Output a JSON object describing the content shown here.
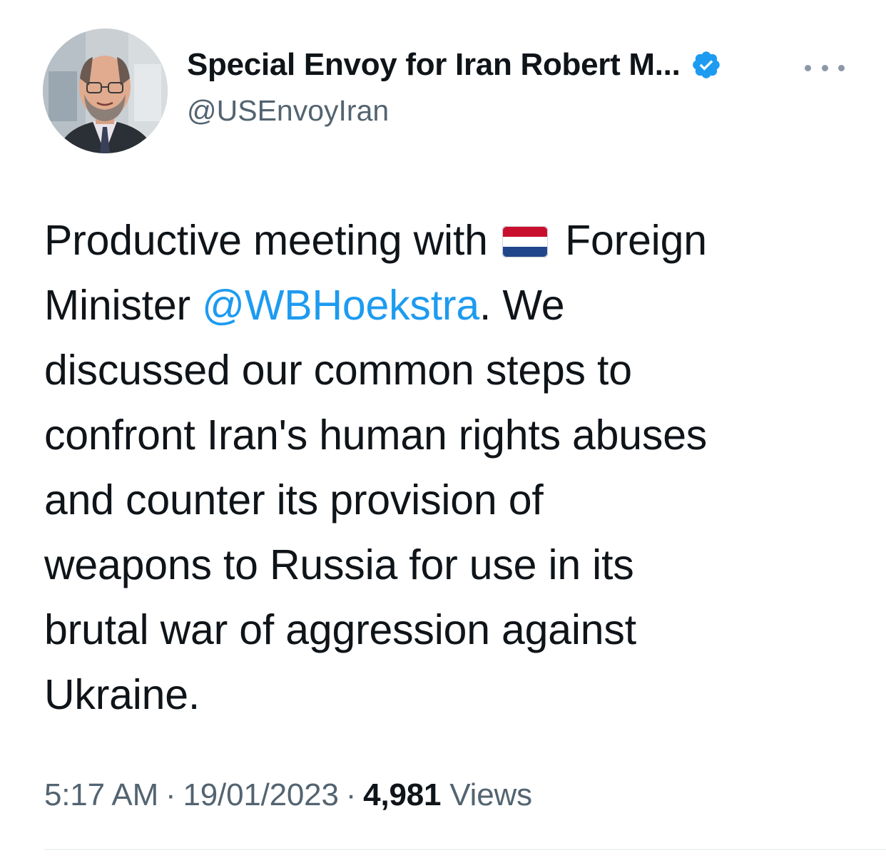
{
  "author": {
    "display_name": "Special Envoy for Iran Robert M...",
    "handle": "@USEnvoyIran",
    "verified": true,
    "avatar_icon": "profile-photo"
  },
  "tweet": {
    "lines": [
      {
        "before": "Productive meeting with",
        "flag": "netherlands-flag-icon",
        "after": "Foreign"
      },
      {
        "before": "Minister ",
        "mention": "@WBHoekstra",
        "after": ". We"
      },
      {
        "text": "discussed our common steps to"
      },
      {
        "text": "confront Iran's human rights abuses"
      },
      {
        "text": "and counter its provision of"
      },
      {
        "text": "weapons to Russia for use in its"
      },
      {
        "text": "brutal war of aggression against"
      },
      {
        "text": "Ukraine."
      }
    ]
  },
  "meta": {
    "time": "5:17 AM",
    "separator": "·",
    "date": "19/01/2023",
    "views_count": "4,981",
    "views_label": "Views"
  },
  "colors": {
    "link": "#1d9bf0",
    "verified": "#1d9bf0",
    "secondary_text": "#536471",
    "primary_text": "#0f1419"
  }
}
